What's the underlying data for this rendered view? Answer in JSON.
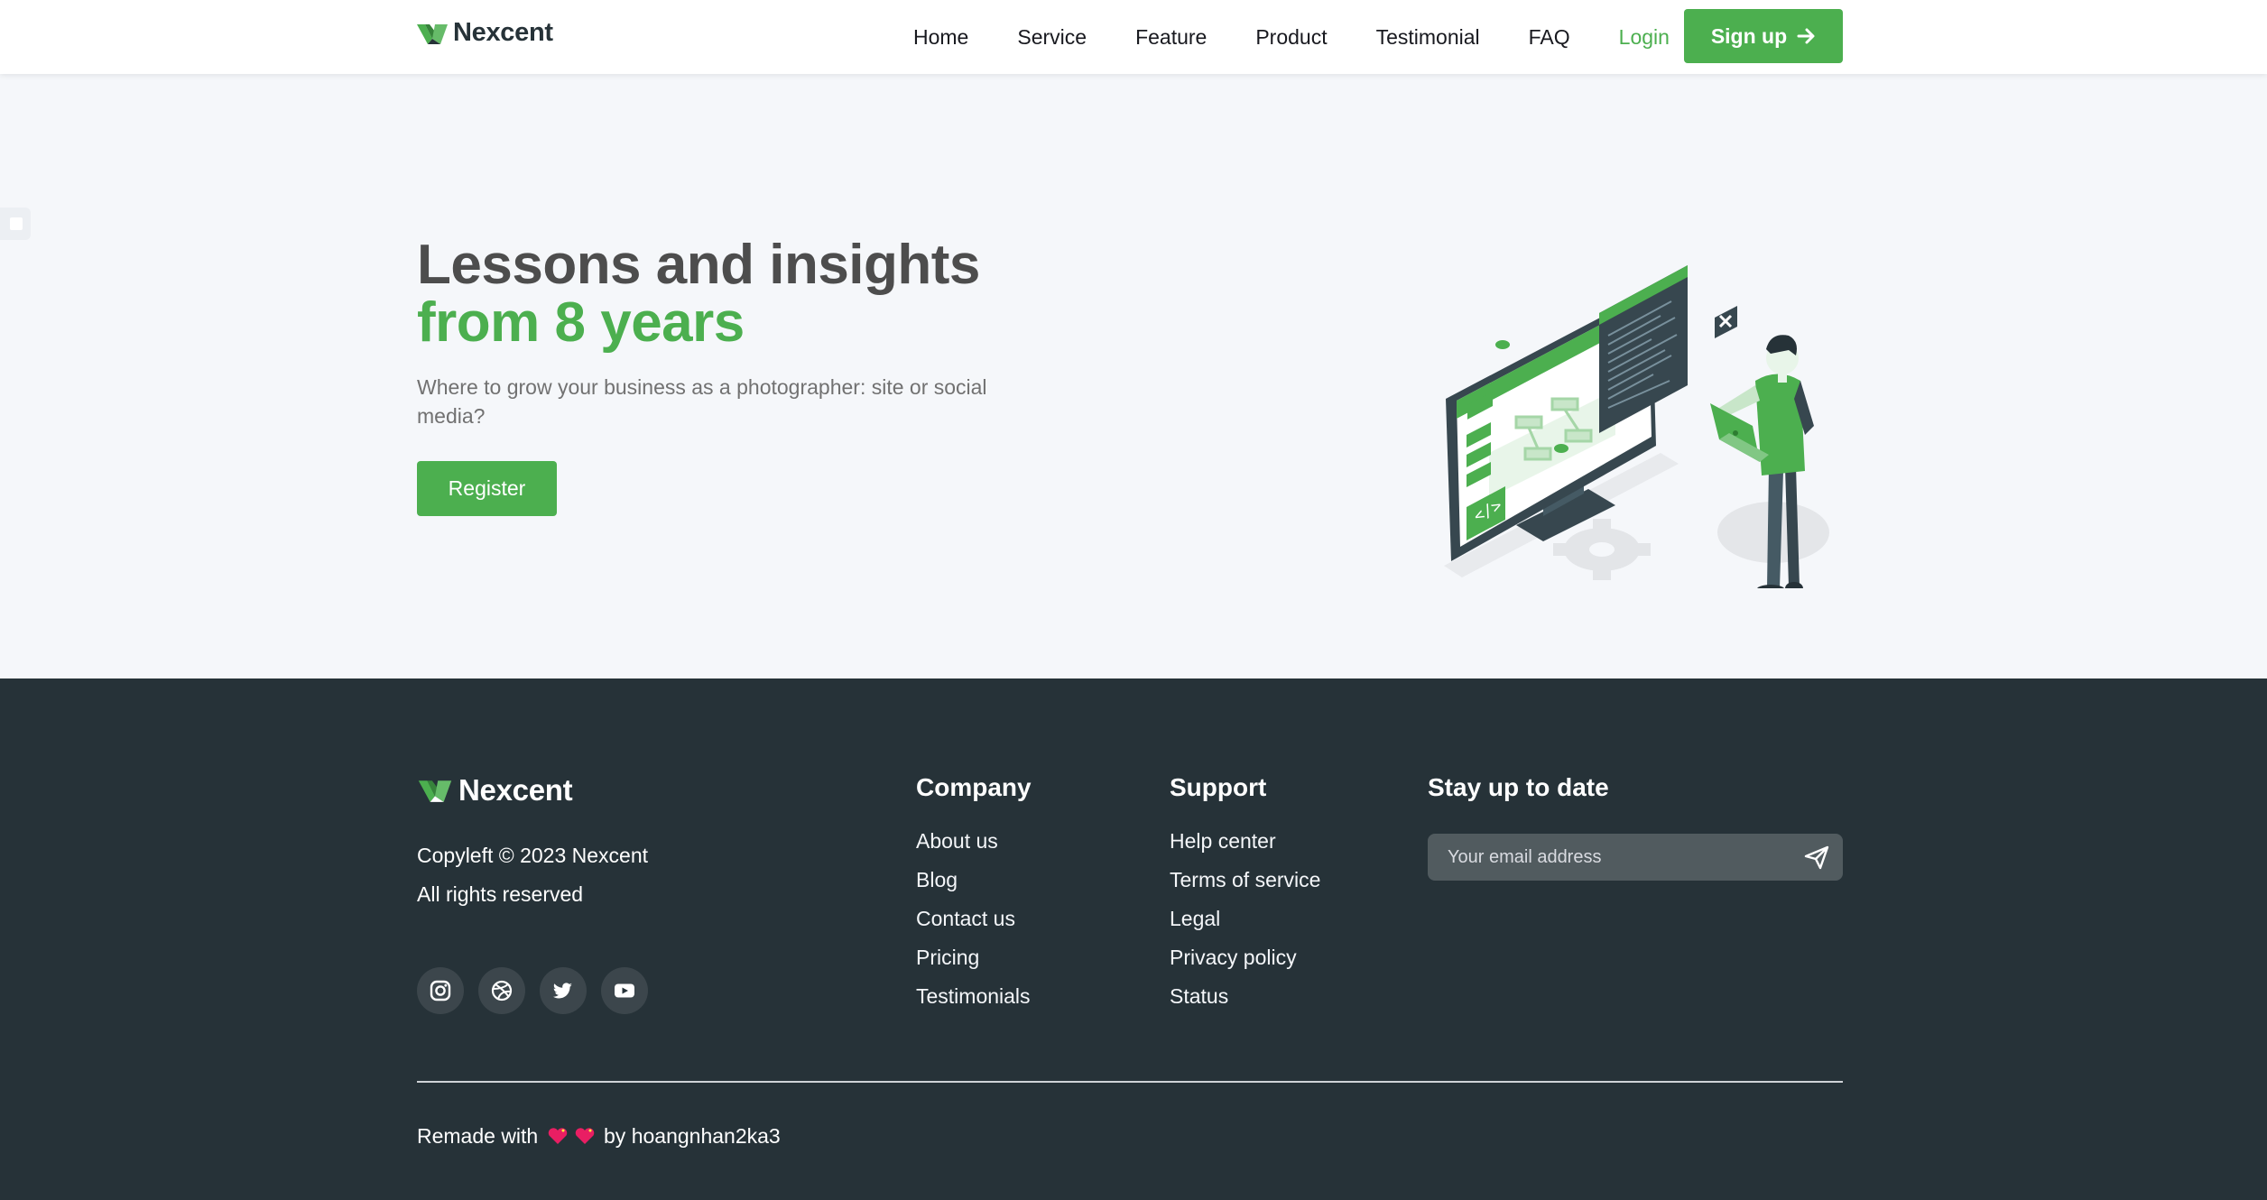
{
  "header": {
    "brand": "Nexcent",
    "nav": [
      "Home",
      "Service",
      "Feature",
      "Product",
      "Testimonial",
      "FAQ"
    ],
    "login": "Login",
    "signup": "Sign up",
    "signup_icon": "arrow-right-icon"
  },
  "hero": {
    "title_line1": "Lessons and insights",
    "title_line2": "from 8 years",
    "subtitle": "Where to grow your business as a photographer: site or social media?",
    "register": "Register"
  },
  "footer": {
    "brand": "Nexcent",
    "copyright": "Copyleft © 2023 Nexcent",
    "rights": "All rights reserved",
    "socials": [
      "instagram-icon",
      "dribbble-icon",
      "twitter-icon",
      "youtube-icon"
    ],
    "company": {
      "heading": "Company",
      "links": [
        "About us",
        "Blog",
        "Contact us",
        "Pricing",
        "Testimonials"
      ]
    },
    "support": {
      "heading": "Support",
      "links": [
        "Help center",
        "Terms of service",
        "Legal",
        "Privacy policy",
        "Status"
      ]
    },
    "stay": {
      "heading": "Stay up to date",
      "email_placeholder": "Your email address"
    },
    "remade_prefix": "Remade with",
    "remade_suffix": "by hoangnhan2ka3"
  },
  "colors": {
    "primary": "#4caf4f",
    "dark": "#263238",
    "hero_bg": "#f5f7fa",
    "heading_gray": "#4d4d4d",
    "text_gray": "#717171"
  }
}
